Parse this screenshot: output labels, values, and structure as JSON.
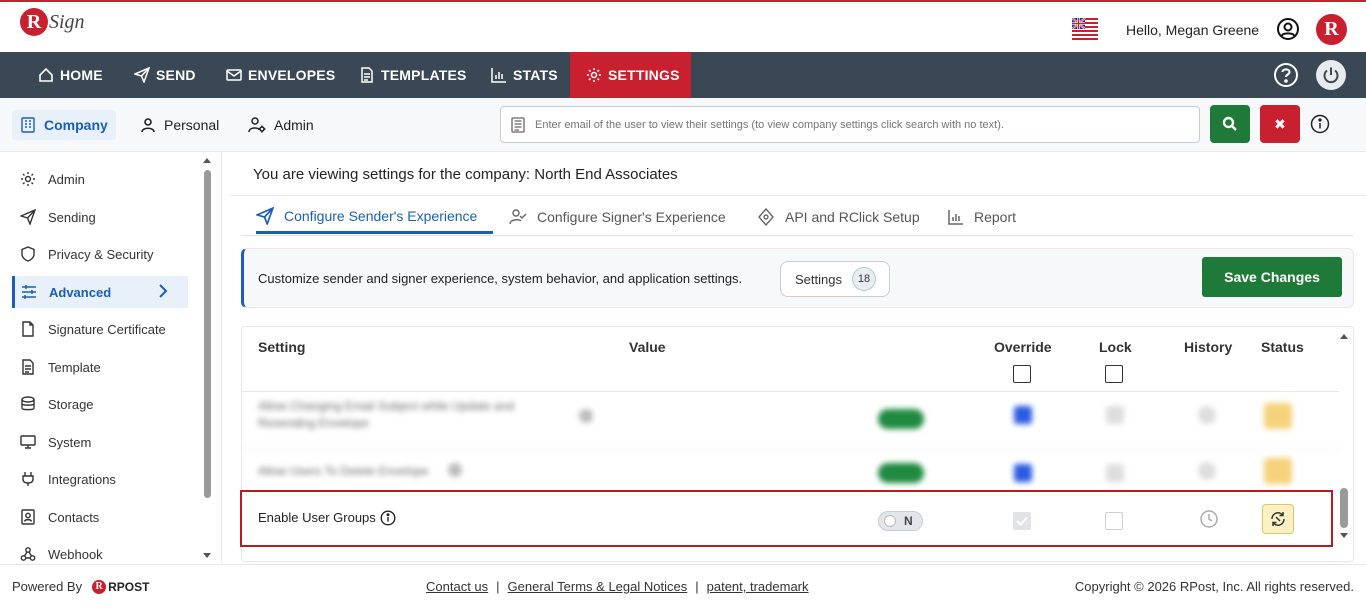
{
  "header": {
    "logo_letter": "R",
    "logo_text": "Sign",
    "greeting": "Hello, Megan Greene",
    "brand_letter": "R"
  },
  "nav": {
    "items": [
      {
        "label": "HOME",
        "icon": "home-icon"
      },
      {
        "label": "SEND",
        "icon": "send-icon"
      },
      {
        "label": "ENVELOPES",
        "icon": "envelope-icon"
      },
      {
        "label": "TEMPLATES",
        "icon": "template-icon"
      },
      {
        "label": "STATS",
        "icon": "chart-icon"
      },
      {
        "label": "SETTINGS",
        "icon": "gear-icon",
        "active": true
      }
    ],
    "colors": {
      "bar": "#3a4856",
      "active": "#c8202f"
    }
  },
  "subnav": {
    "tabs": [
      {
        "label": "Company",
        "active": true
      },
      {
        "label": "Personal"
      },
      {
        "label": "Admin"
      }
    ],
    "search_placeholder": "Enter email of the user to view their settings (to view company settings click search with no text).",
    "clear_label": "✖"
  },
  "sidebar": {
    "items": [
      {
        "label": "Admin",
        "icon": "gear-icon"
      },
      {
        "label": "Sending",
        "icon": "send-icon"
      },
      {
        "label": "Privacy & Security",
        "icon": "shield-icon"
      },
      {
        "label": "Advanced",
        "icon": "sliders-icon",
        "active": true
      },
      {
        "label": "Signature Certificate",
        "icon": "certificate-icon"
      },
      {
        "label": "Template",
        "icon": "template-icon"
      },
      {
        "label": "Storage",
        "icon": "database-icon"
      },
      {
        "label": "System",
        "icon": "monitor-icon"
      },
      {
        "label": "Integrations",
        "icon": "plug-icon"
      },
      {
        "label": "Contacts",
        "icon": "contacts-icon"
      },
      {
        "label": "Webhook",
        "icon": "webhook-icon"
      }
    ]
  },
  "main": {
    "title": "You are viewing settings for the company: North End Associates",
    "tabs": [
      {
        "label": "Configure Sender's Experience",
        "active": true
      },
      {
        "label": "Configure Signer's Experience"
      },
      {
        "label": "API and RClick Setup"
      },
      {
        "label": "Report"
      }
    ],
    "banner_text": "Customize sender and signer experience, system behavior, and application settings.",
    "settings_label": "Settings",
    "settings_count": "18",
    "save_label": "Save Changes"
  },
  "table": {
    "headers": {
      "setting": "Setting",
      "value": "Value",
      "override": "Override",
      "lock": "Lock",
      "history": "History",
      "status": "Status"
    },
    "blurred_rows": [
      {
        "label": "Allow Changing Email Subject while Update and Resending Envelope"
      },
      {
        "label": "Allow Users To Delete Envelope"
      }
    ],
    "focus_row": {
      "label": "Enable User Groups",
      "toggle_text": "N",
      "override_checked": true,
      "lock_checked": false
    }
  },
  "footer": {
    "powered_by": "Powered By",
    "rpost_text": "RPOST",
    "links": [
      "Contact us",
      "General Terms & Legal Notices",
      "patent, trademark"
    ],
    "copyright": "Copyright © 2026 RPost, Inc. All rights reserved."
  }
}
